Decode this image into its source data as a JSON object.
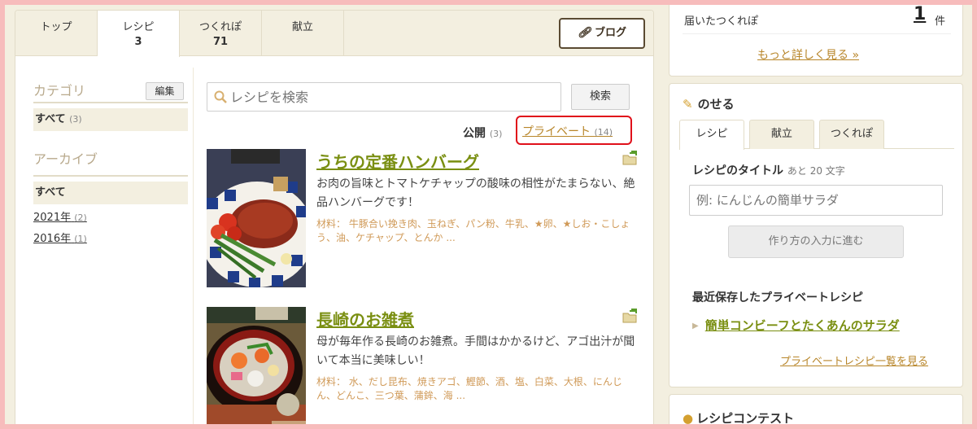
{
  "tabs": [
    {
      "label": "トップ",
      "count": ""
    },
    {
      "label": "レシピ",
      "count": "3"
    },
    {
      "label": "つくれぽ",
      "count": "71"
    },
    {
      "label": "献立",
      "count": ""
    }
  ],
  "blog_button": "ブログ",
  "sidenav": {
    "category_title": "カテゴリ",
    "edit_label": "編集",
    "category_all": "すべて",
    "category_all_count": "(3)",
    "archive_title": "アーカイブ",
    "archive_all": "すべて",
    "years": [
      {
        "label": "2021年",
        "count": "(2)"
      },
      {
        "label": "2016年",
        "count": "(1)"
      }
    ]
  },
  "search": {
    "placeholder": "レシピを検索",
    "button": "検索"
  },
  "filters": {
    "public_label": "公開",
    "public_count": "(3)",
    "private_label": "プライベート",
    "private_count": "(14)"
  },
  "recipes": [
    {
      "title": "うちの定番ハンバーグ",
      "description": "お肉の旨味とトマトケチャップの酸味の相性がたまらない、絶品ハンバーグです！",
      "ingredients": "材料： 牛豚合い挽き肉、玉ねぎ、パン粉、牛乳、★卵、★しお・こしょう、油、ケチャップ、とんか ..."
    },
    {
      "title": "長崎のお雑煮",
      "description": "母が毎年作る長崎のお雑煮。手間はかかるけど、アゴ出汁が聞いて本当に美味しい！",
      "ingredients": "材料： 水、だし昆布、焼きアゴ、鰹節、酒、塩、白菜、大根、にんじん、どんこ、三つ葉、蒲鉾、海 ..."
    }
  ],
  "sidebar": {
    "received_label": "届いたつくれぽ",
    "received_count": "1",
    "received_unit": "件",
    "more_link": "もっと詳しく見る »",
    "post_title": "のせる",
    "post_tabs": [
      "レシピ",
      "献立",
      "つくれぽ"
    ],
    "recipe_title_label": "レシピのタイトル",
    "recipe_title_hint": "あと 20 文字",
    "recipe_title_placeholder": "例: にんじんの簡単サラダ",
    "next_button": "作り方の入力に進む",
    "recent_heading": "最近保存したプライベートレシピ",
    "recent_item": "簡単コンビーフとたくあんのサラダ",
    "private_list_link": "プライベートレシピ一覧を見る",
    "contest_title": "レシピコンテスト"
  },
  "colors": {
    "accent_green": "#7a8f12",
    "link_gold": "#b8862a",
    "highlight_red": "#e0101a",
    "page_bg": "#f3efe0"
  }
}
